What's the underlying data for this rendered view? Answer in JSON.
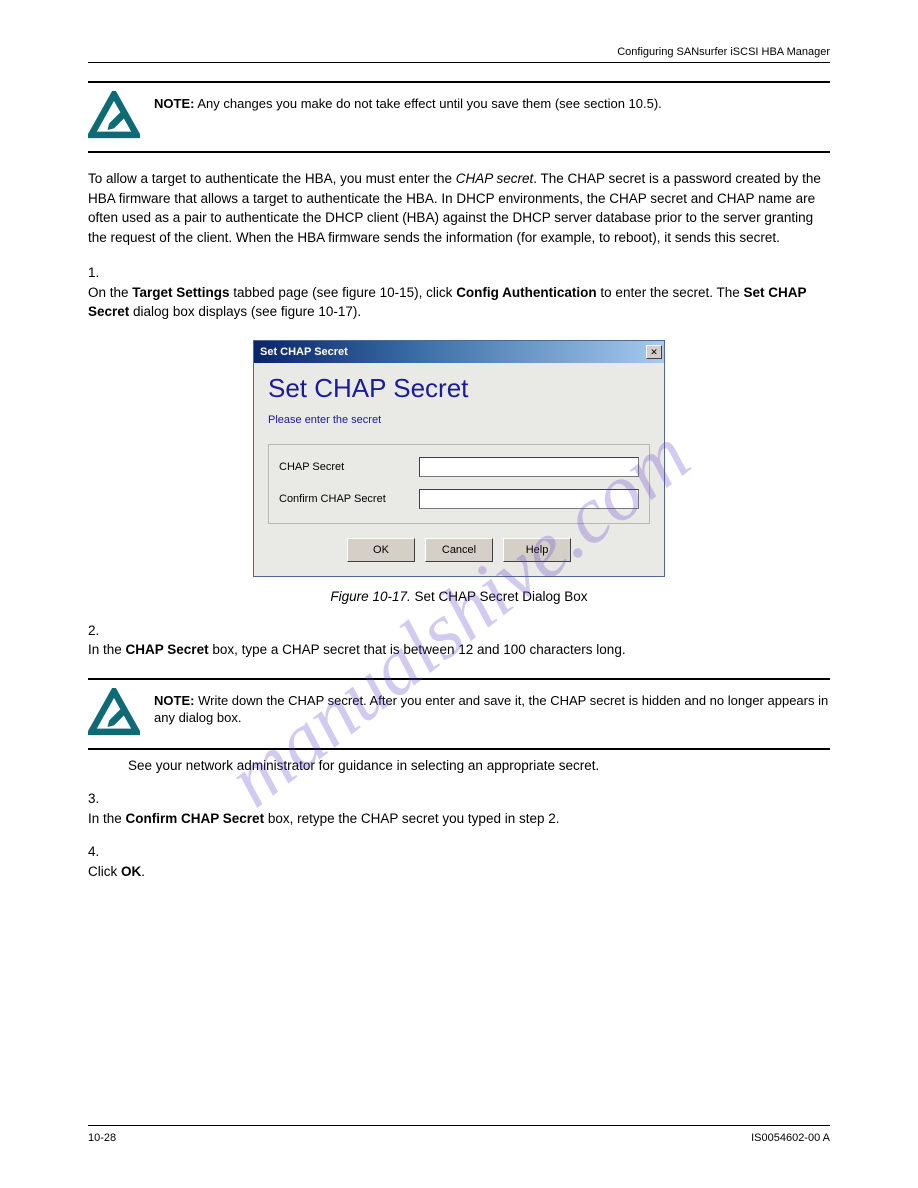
{
  "header": "Configuring SANsurfer iSCSI HBA Manager",
  "notes": [
    {
      "label": "NOTE:",
      "text": "Any changes you make do not take effect until you save them (see section 10.5)."
    },
    {
      "label": "NOTE:",
      "text": "Write down the CHAP secret. After you enter and save it, the CHAP secret is hidden and no longer appears in any dialog box."
    }
  ],
  "para1_prefix": "To allow a target to authenticate the HBA, you must enter the ",
  "para1_em": "CHAP secret",
  "para1_suffix": ". The CHAP secret is a password created by the HBA firmware that allows a target to authenticate the HBA. In DHCP environments, the CHAP secret and CHAP name are often used as a pair to authenticate the DHCP client (HBA) against the DHCP server database prior to the server granting the request of the client. When the HBA firmware sends the information (for example, to reboot), it sends this secret.",
  "step1": {
    "num": "1.",
    "text_pre": "On the ",
    "bold1": "Target Settings",
    "text_mid1": " tabbed page (see figure 10-15), click ",
    "bold2": "Config Authentication",
    "text_mid2": " to enter the secret. The ",
    "bold3": "Set CHAP Secret",
    "text_end": " dialog box displays (see figure 10-17)."
  },
  "figcap_prefix": "Figure 10-17.  ",
  "figcap_text": "Set CHAP Secret Dialog Box",
  "step2": {
    "num": "2.",
    "text_pre": "In the ",
    "bold": "CHAP Secret",
    "text_post": " box, type a CHAP secret that is between 12 and 100 characters long."
  },
  "para2": "See your network administrator for guidance in selecting an appropriate secret.",
  "step3": {
    "num": "3.",
    "text_pre": "In the ",
    "bold": "Confirm CHAP Secret",
    "text_post": " box, retype the CHAP secret you typed in step 2."
  },
  "step4": {
    "num": "4.",
    "text_pre": "Click ",
    "bold": "OK",
    "text_post": "."
  },
  "footer_left": "10-28",
  "footer_right": "IS0054602-00 A",
  "watermark": "manualshive.com",
  "dialog": {
    "titlebar": "Set CHAP Secret",
    "close": "✕",
    "title": "Set CHAP Secret",
    "instruction": "Please enter the secret",
    "fields": {
      "chap_label": "CHAP Secret",
      "chap_value": "",
      "confirm_label": "Confirm CHAP Secret",
      "confirm_value": ""
    },
    "buttons": {
      "ok": "OK",
      "cancel": "Cancel",
      "help": "Help"
    }
  }
}
